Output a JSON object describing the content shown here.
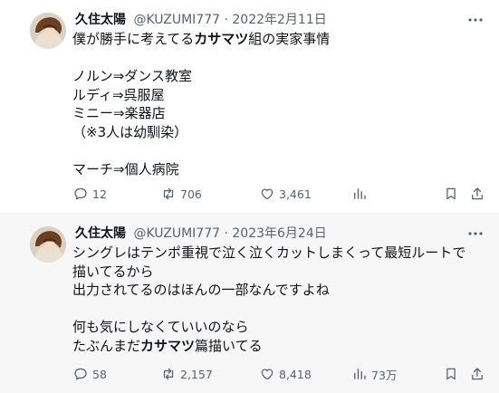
{
  "tweets": [
    {
      "author": {
        "name": "久住太陽",
        "handle": "@KUZUMI777"
      },
      "separator": "·",
      "date": "2022年2月11日",
      "lines": [
        [
          {
            "t": "僕が勝手に考えてる"
          },
          {
            "t": "カサマツ",
            "bold": true
          },
          {
            "t": "組の実家事情"
          }
        ],
        [],
        [
          {
            "t": "ノルン⇒ダンス教室"
          }
        ],
        [
          {
            "t": "ルディ⇒呉服屋"
          }
        ],
        [
          {
            "t": "ミニー⇒楽器店"
          }
        ],
        [
          {
            "t": "（※3人は幼馴染）"
          }
        ],
        [],
        [
          {
            "t": "マーチ⇒個人病院"
          }
        ]
      ],
      "stats": {
        "replies": "12",
        "retweets": "706",
        "likes": "3,461",
        "views": ""
      }
    },
    {
      "author": {
        "name": "久住太陽",
        "handle": "@KUZUMI777"
      },
      "separator": "·",
      "date": "2023年6月24日",
      "lines": [
        [
          {
            "t": "シングレはテンポ重視で泣く泣くカットしまくって最短ルートで"
          }
        ],
        [
          {
            "t": "描いてるから"
          }
        ],
        [
          {
            "t": "出力されてるのはほんの一部なんですよね"
          }
        ],
        [],
        [
          {
            "t": "何も気にしなくていいのなら"
          }
        ],
        [
          {
            "t": "たぶんまだ"
          },
          {
            "t": "カサマツ",
            "bold": true
          },
          {
            "t": "篇描いてる"
          }
        ]
      ],
      "stats": {
        "replies": "58",
        "retweets": "2,157",
        "likes": "8,418",
        "views": "73万"
      }
    }
  ],
  "icons": {
    "more": "more-dots-icon",
    "reply": "reply-bubble-icon",
    "retweet": "retweet-icon",
    "like": "heart-icon",
    "views": "analytics-bars-icon",
    "bookmark": "bookmark-icon",
    "share": "share-upload-icon"
  },
  "colors": {
    "text": "#0f1419",
    "muted": "#536471",
    "second_tweet_bg": "#f7f7f7"
  }
}
